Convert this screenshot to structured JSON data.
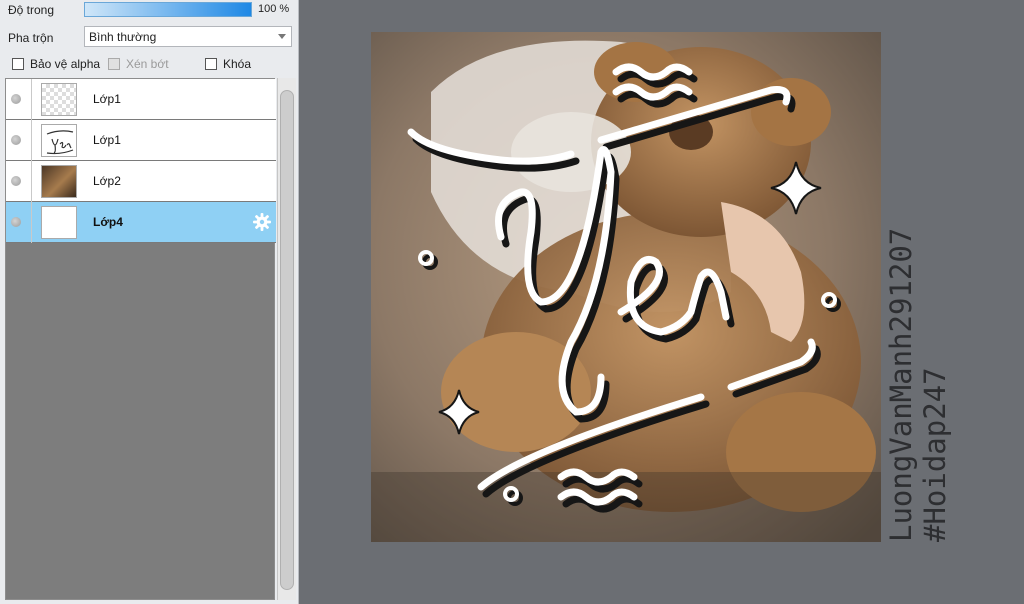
{
  "panel": {
    "opacity_label": "Độ trong",
    "opacity_value": "100 %",
    "opacity_fraction": 1.0,
    "blend_label": "Pha trộn",
    "blend_value": "Bình thường",
    "checkboxes": [
      {
        "label": "Bảo vệ alpha",
        "checked": false,
        "disabled": false
      },
      {
        "label": "Xén bớt",
        "checked": false,
        "disabled": true
      },
      {
        "label": "Khóa",
        "checked": false,
        "disabled": false
      }
    ],
    "layers": [
      {
        "name": "Lớp1",
        "thumb": "transparent",
        "selected": false
      },
      {
        "name": "Lớp1",
        "thumb": "lettering",
        "selected": false
      },
      {
        "name": "Lớp2",
        "thumb": "photo",
        "selected": false
      },
      {
        "name": "Lớp4",
        "thumb": "white",
        "selected": true
      }
    ]
  },
  "canvas": {
    "lettering": "Yen"
  },
  "watermark": {
    "line1": "LuongVanManh291207",
    "line2": "#Hoidap247"
  },
  "colors": {
    "accent": "#1e88e5",
    "selected_layer": "#8fd0f4",
    "workspace": "#6b6e73"
  }
}
